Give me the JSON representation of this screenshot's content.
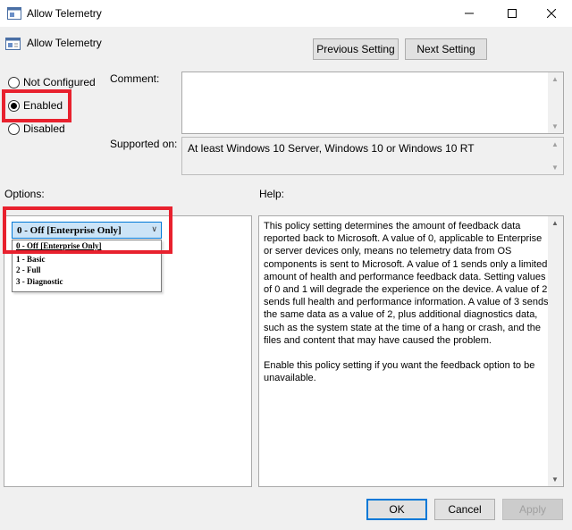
{
  "window": {
    "title": "Allow Telemetry",
    "minimize_glyph": "—",
    "close_glyph": "✕"
  },
  "header": {
    "policy_name": "Allow Telemetry",
    "previous_setting": "Previous Setting",
    "next_setting": "Next Setting"
  },
  "state": {
    "options": [
      {
        "label": "Not Configured",
        "checked": false
      },
      {
        "label": "Enabled",
        "checked": true
      },
      {
        "label": "Disabled",
        "checked": false
      }
    ]
  },
  "comment": {
    "label": "Comment:",
    "value": ""
  },
  "supported_on": {
    "label": "Supported on:",
    "value": "At least Windows 10 Server, Windows 10 or Windows 10 RT"
  },
  "options_section": {
    "label": "Options:",
    "combo_selected": "0 - Off [Enterprise Only]",
    "dropdown_items": [
      "0 - Off [Enterprise Only]",
      "1 - Basic",
      "2 - Full",
      "3 - Diagnostic"
    ]
  },
  "help_section": {
    "label": "Help:",
    "paragraph1": "This policy setting determines the amount of feedback data reported back to Microsoft. A value of 0, applicable to Enterprise or server devices only, means no telemetry data from OS components is sent to Microsoft. A value of 1 sends only a limited amount of health and performance feedback data. Setting values of 0 and 1 will degrade the experience on the device. A value of 2 sends full health and performance information. A value of 3 sends the same data as a value of 2, plus additional diagnostics data, such as the system state at the time of a hang or crash, and the files and content that may have caused the problem.",
    "paragraph2": "Enable this policy setting if you want the feedback option to be unavailable."
  },
  "footer": {
    "ok": "OK",
    "cancel": "Cancel",
    "apply": "Apply"
  },
  "colors": {
    "highlight_box": "#e8212e",
    "focus_blue": "#0078d7"
  }
}
